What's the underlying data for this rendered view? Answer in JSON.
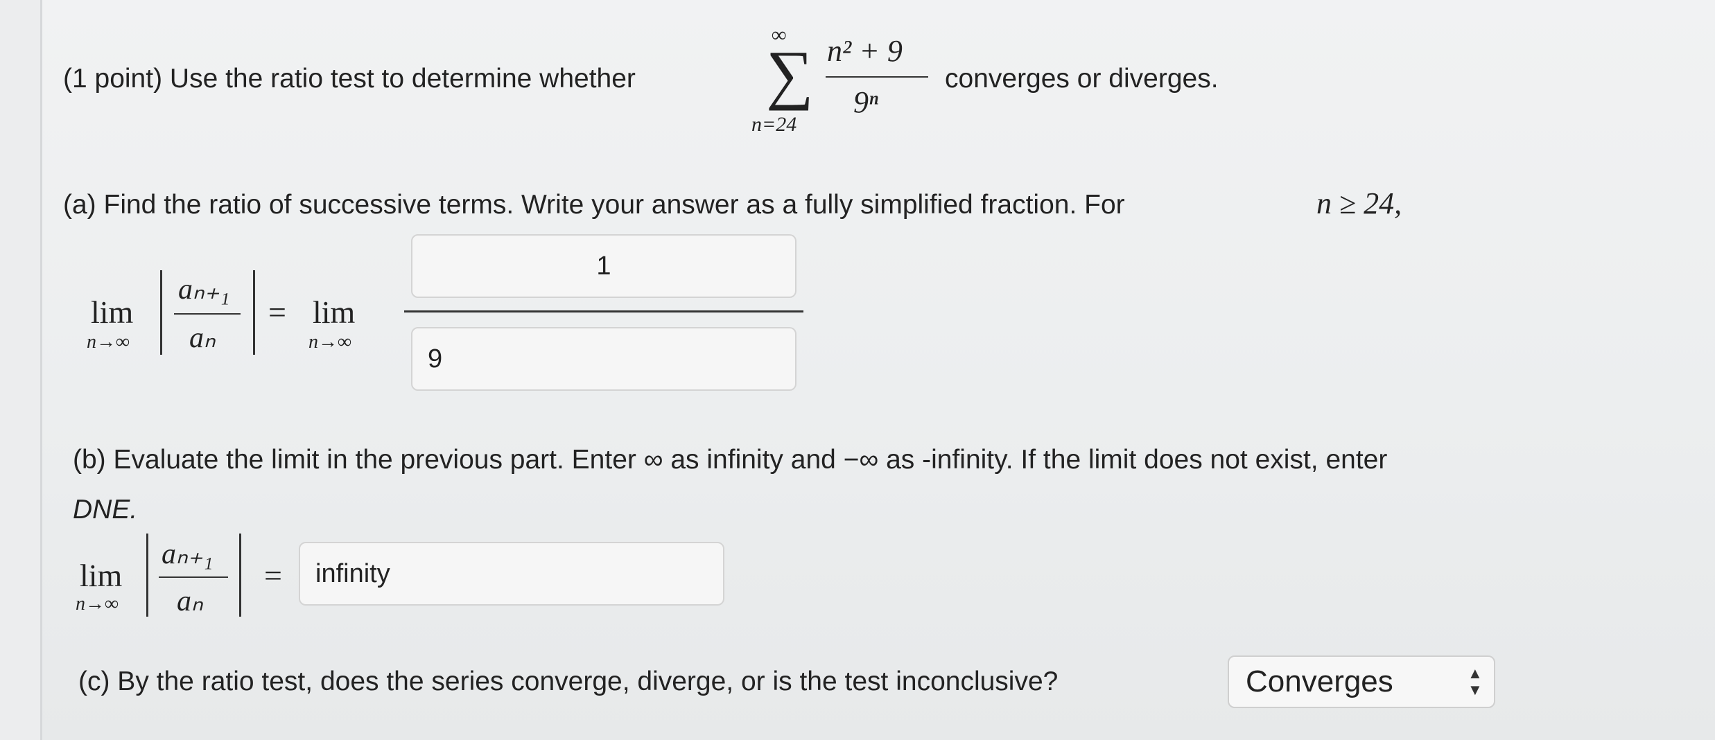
{
  "problem": {
    "intro_pre": "(1 point) Use the ratio test to determine whether",
    "intro_post": "converges or diverges.",
    "sum_upper": "∞",
    "sum_lower": "n=24",
    "sum_symbol": "∑",
    "term_num": "n² + 9",
    "term_den": "9ⁿ"
  },
  "part_a": {
    "prompt": "(a) Find the ratio of successive terms. Write your answer as a fully simplified fraction. For",
    "condition": "n ≥ 24,",
    "lim_word": "lim",
    "lim_sub": "n→∞",
    "ratio_num": "aₙ₊₁",
    "ratio_den": "aₙ",
    "equals": "=",
    "numerator_value": "1",
    "denominator_value": "9"
  },
  "part_b": {
    "prompt_line1": "(b) Evaluate the limit in the previous part. Enter ∞ as infinity and −∞ as -infinity. If the limit does not exist, enter",
    "prompt_line2": "DNE.",
    "lim_word": "lim",
    "lim_sub": "n→∞",
    "ratio_num": "aₙ₊₁",
    "ratio_den": "aₙ",
    "equals": "=",
    "answer_value": "infinity"
  },
  "part_c": {
    "prompt": "(c) By the ratio test, does the series converge, diverge, or is the test inconclusive?",
    "selected": "Converges",
    "select_arrows": "▲▼"
  }
}
